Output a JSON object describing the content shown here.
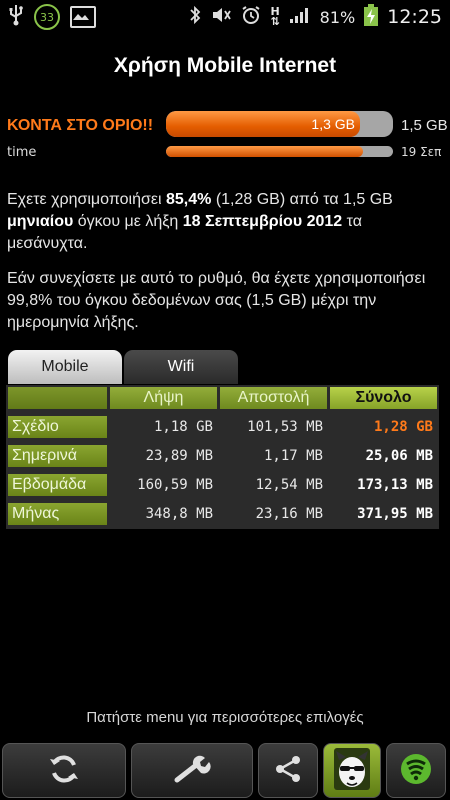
{
  "status_bar": {
    "notification_badge": "33",
    "battery_percent": "81%",
    "clock": "12:25",
    "network": "H",
    "icons": [
      "usb-icon",
      "badge-icon",
      "image-icon",
      "bluetooth-icon",
      "mute-icon",
      "alarm-icon",
      "signal-icon",
      "battery-icon"
    ]
  },
  "title": "Χρήση Mobile Internet",
  "usage": {
    "label": "ΚΟΝΤΑ ΣΤΟ ΟΡΙΟ!!",
    "used_text": "1,3 GB",
    "limit_text": "1,5 GB",
    "fill_fraction": 0.854,
    "color": "#ff7a1a"
  },
  "time": {
    "label": "time",
    "end_text": "19 Σεπ",
    "fill_fraction": 0.87
  },
  "summary": {
    "p1_a": "Εχετε χρησιμοποιήσει ",
    "p1_b": "85,4%",
    "p1_c": " (1,28 GB) από τα 1,5 GB ",
    "p1_d": "μηνιαίου",
    "p1_e": " όγκου με λήξη ",
    "p1_f": "18 Σεπτεμβρίου 2012",
    "p1_g": " τα μεσάνυχτα.",
    "p2": "Εάν συνεχίσετε με αυτό το ρυθμό, θα έχετε χρησιμοποιήσει 99,8% του όγκου δεδομένων σας (1,5 GB) μέχρι την ημερομηνία λήξης."
  },
  "tabs": [
    {
      "label": "Mobile",
      "active": true
    },
    {
      "label": "Wifi",
      "active": false
    }
  ],
  "table": {
    "headers": [
      "Λήψη",
      "Αποστολή",
      "Σύνολο"
    ],
    "rows": [
      {
        "label": "Σχέδιο",
        "download": "1,18 GB",
        "upload": "101,53 MB",
        "total": "1,28 GB"
      },
      {
        "label": "Σημερινά",
        "download": "23,89 MB",
        "upload": "1,17 MB",
        "total": "25,06 MB"
      },
      {
        "label": "Εβδομάδα",
        "download": "160,59 MB",
        "upload": "12,54 MB",
        "total": "173,13 MB"
      },
      {
        "label": "Μήνας",
        "download": "348,8 MB",
        "upload": "23,16 MB",
        "total": "371,95 MB"
      }
    ]
  },
  "hint": "Πατήστε menu για περισσότερες επιλογές",
  "toolbar": [
    "refresh-icon",
    "settings-wrench-icon",
    "share-icon",
    "app-mascot-icon",
    "security-shield-icon"
  ]
}
